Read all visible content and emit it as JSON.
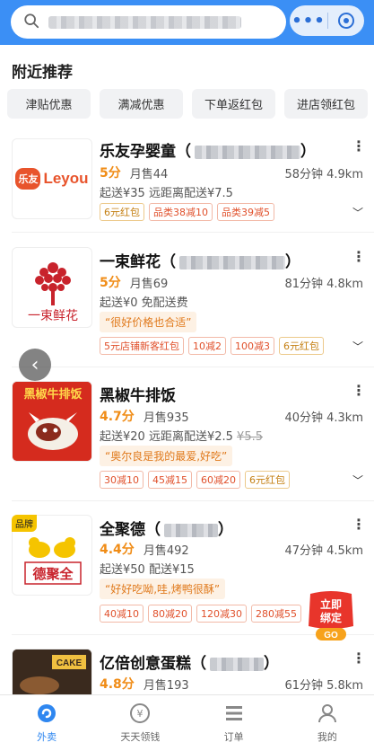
{
  "search": {
    "placeholder": ""
  },
  "capsule": {
    "more": "•••"
  },
  "section_title": "附近推荐",
  "filters": [
    "津贴优惠",
    "满减优惠",
    "下单返红包",
    "进店领红包"
  ],
  "stores": [
    {
      "name": "乐友孕婴童（",
      "name_end": "）",
      "score": "5分",
      "sales": "月售44",
      "time_dist": "58分钟 4.9km",
      "delivery": "起送¥35  远距离配送¥7.5",
      "tags": [
        "6元红包",
        "品类38减10",
        "品类39减5"
      ],
      "logo_text": "Leyou",
      "logo_cn": "乐友"
    },
    {
      "name": "一束鲜花（",
      "name_end": "）",
      "score": "5分",
      "sales": "月售69",
      "time_dist": "81分钟 4.8km",
      "delivery": "起送¥0  免配送费",
      "quote": "“很好价格也合适”",
      "tags": [
        "5元店铺新客红包",
        "10减2",
        "100减3",
        "6元红包"
      ],
      "logo_text": "一束鲜花"
    },
    {
      "name": "黑椒牛排饭",
      "score": "4.7分",
      "sales": "月售935",
      "time_dist": "40分钟 4.3km",
      "delivery": "起送¥20  远距离配送¥2.5",
      "delivery_old": "¥5.5",
      "quote": "“奥尔良是我的最爱,好吃”",
      "tags": [
        "30减10",
        "45减15",
        "60减20",
        "6元红包"
      ],
      "logo_text": "黑椒牛排饭"
    },
    {
      "name": "全聚德（",
      "name_end": "）",
      "badge": "品牌",
      "score": "4.4分",
      "sales": "月售492",
      "time_dist": "47分钟 4.5km",
      "delivery": "起送¥50  配送¥15",
      "quote": "“好好吃呦,哇,烤鸭很酥”",
      "tags": [
        "40减10",
        "80减20",
        "120减30",
        "280减55"
      ],
      "logo_text": "德聚全"
    },
    {
      "name": "亿倍创意蛋糕（",
      "name_end": "）",
      "score": "4.8分",
      "sales": "月售193",
      "time_dist": "61分钟 5.8km",
      "logo_text": "CAKE"
    }
  ],
  "promo": {
    "line1": "立即",
    "line2": "绑定",
    "go": "GO"
  },
  "tabs": [
    "外卖",
    "天天领钱",
    "订单",
    "我的"
  ],
  "colors": {
    "header": "#3b8ff5",
    "accent": "#2f87f0",
    "score": "#f08c16"
  }
}
